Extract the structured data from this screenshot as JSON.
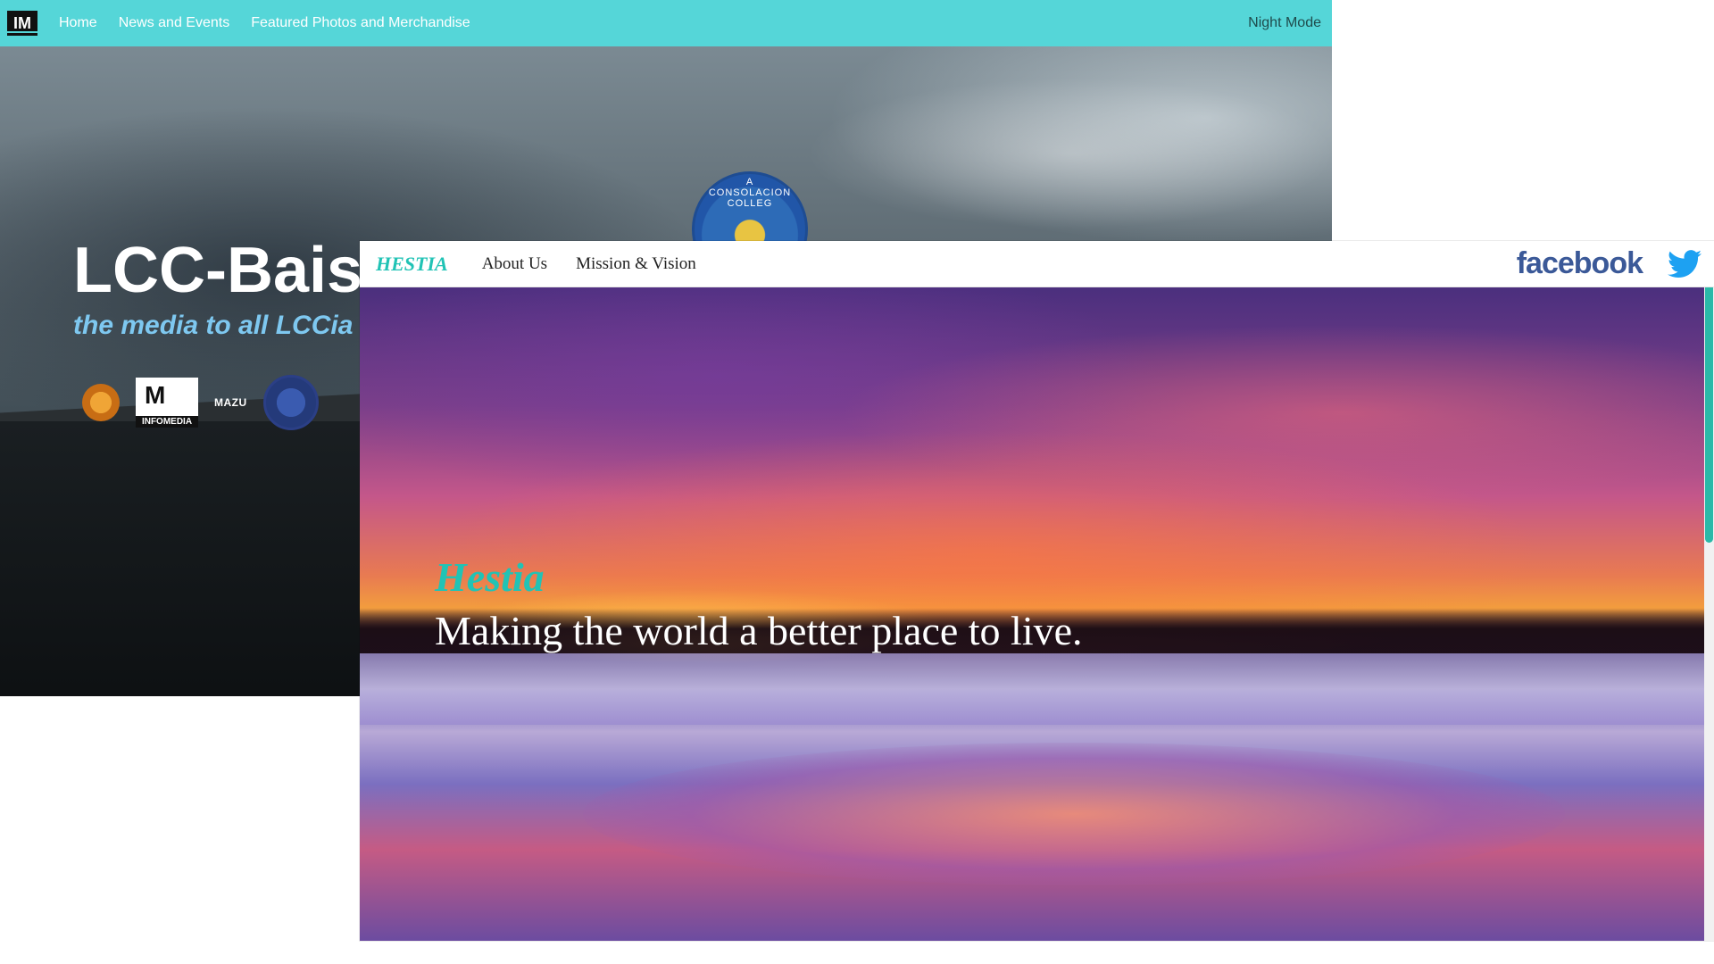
{
  "back_site": {
    "nav": {
      "logo_text": "IM",
      "links": [
        "Home",
        "News and Events",
        "Featured Photos and Merchandise"
      ],
      "night_mode": "Night Mode"
    },
    "hero": {
      "title": "LCC-Bais",
      "subtitle": "the media to all LCCia",
      "seal_text": "A CONSOLACION COLLEG",
      "logos": {
        "infomedia_mark": "M",
        "infomedia_label": "INFOMEDIA",
        "mazu_label": "MAZU"
      }
    }
  },
  "front_site": {
    "nav": {
      "brand": "HESTIA",
      "links": [
        "About Us",
        "Mission & Vision"
      ],
      "facebook": "facebook",
      "twitter_icon": "twitter-icon"
    },
    "hero": {
      "title": "Hestia",
      "subtitle": "Making the world a better place to live."
    }
  },
  "colors": {
    "back_nav_bg": "#55d6d8",
    "back_subtitle": "#7ec8f0",
    "front_brand": "#21c3b5",
    "facebook_blue": "#3b5998",
    "twitter_blue": "#1da1f2",
    "scroll_thumb": "#2ab9a8"
  }
}
